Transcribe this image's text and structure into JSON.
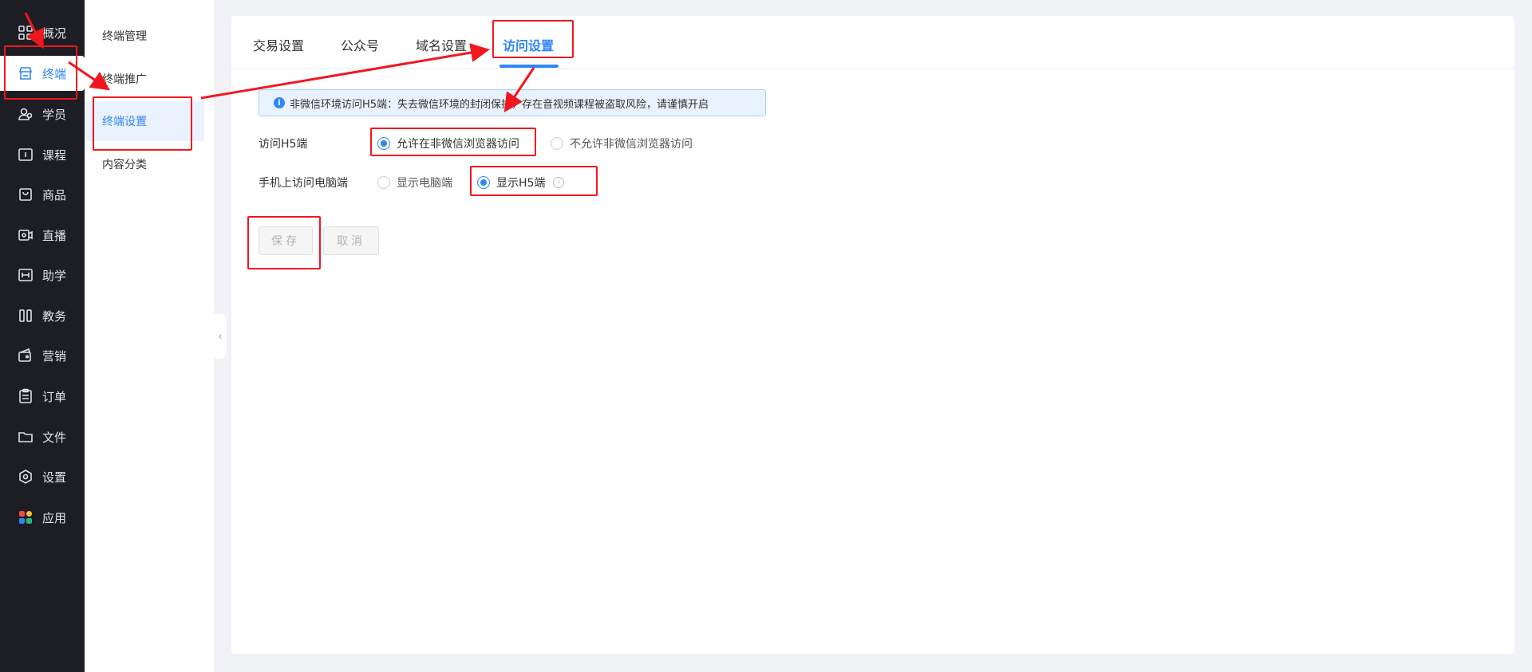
{
  "nav": {
    "items": [
      {
        "label": "概况",
        "icon": "grid-icon"
      },
      {
        "label": "终端",
        "icon": "store-icon"
      },
      {
        "label": "学员",
        "icon": "users-icon"
      },
      {
        "label": "课程",
        "icon": "course-icon"
      },
      {
        "label": "商品",
        "icon": "bag-icon"
      },
      {
        "label": "直播",
        "icon": "video-icon"
      },
      {
        "label": "助学",
        "icon": "study-icon"
      },
      {
        "label": "教务",
        "icon": "columns-icon"
      },
      {
        "label": "营销",
        "icon": "wallet-icon"
      },
      {
        "label": "订单",
        "icon": "clipboard-icon"
      },
      {
        "label": "文件",
        "icon": "folder-icon"
      },
      {
        "label": "设置",
        "icon": "hexagon-icon"
      },
      {
        "label": "应用",
        "icon": "apps-icon"
      }
    ],
    "active": "终端"
  },
  "submenu": {
    "items": [
      {
        "label": "终端管理"
      },
      {
        "label": "终端推广"
      },
      {
        "label": "终端设置"
      },
      {
        "label": "内容分类"
      }
    ],
    "active": "终端设置"
  },
  "tabs": [
    {
      "label": "交易设置"
    },
    {
      "label": "公众号"
    },
    {
      "label": "域名设置"
    },
    {
      "label": "访问设置"
    }
  ],
  "active_tab": "访问设置",
  "notice": {
    "text": "非微信环境访问H5端：失去微信环境的封闭保护，存在音视频课程被盗取风险，请谨慎开启"
  },
  "form": {
    "h5_access": {
      "label": "访问H5端",
      "options": [
        "允许在非微信浏览器访问",
        "不允许非微信浏览器访问"
      ],
      "selected": "允许在非微信浏览器访问"
    },
    "mobile_pc": {
      "label": "手机上访问电脑端",
      "options": [
        "显示电脑端",
        "显示H5端"
      ],
      "selected": "显示H5端"
    }
  },
  "buttons": {
    "save": "保存",
    "cancel": "取消"
  },
  "colors": {
    "accent": "#2f86f6",
    "nav_bg": "#1c1e24",
    "annotation": "#f2171d"
  }
}
